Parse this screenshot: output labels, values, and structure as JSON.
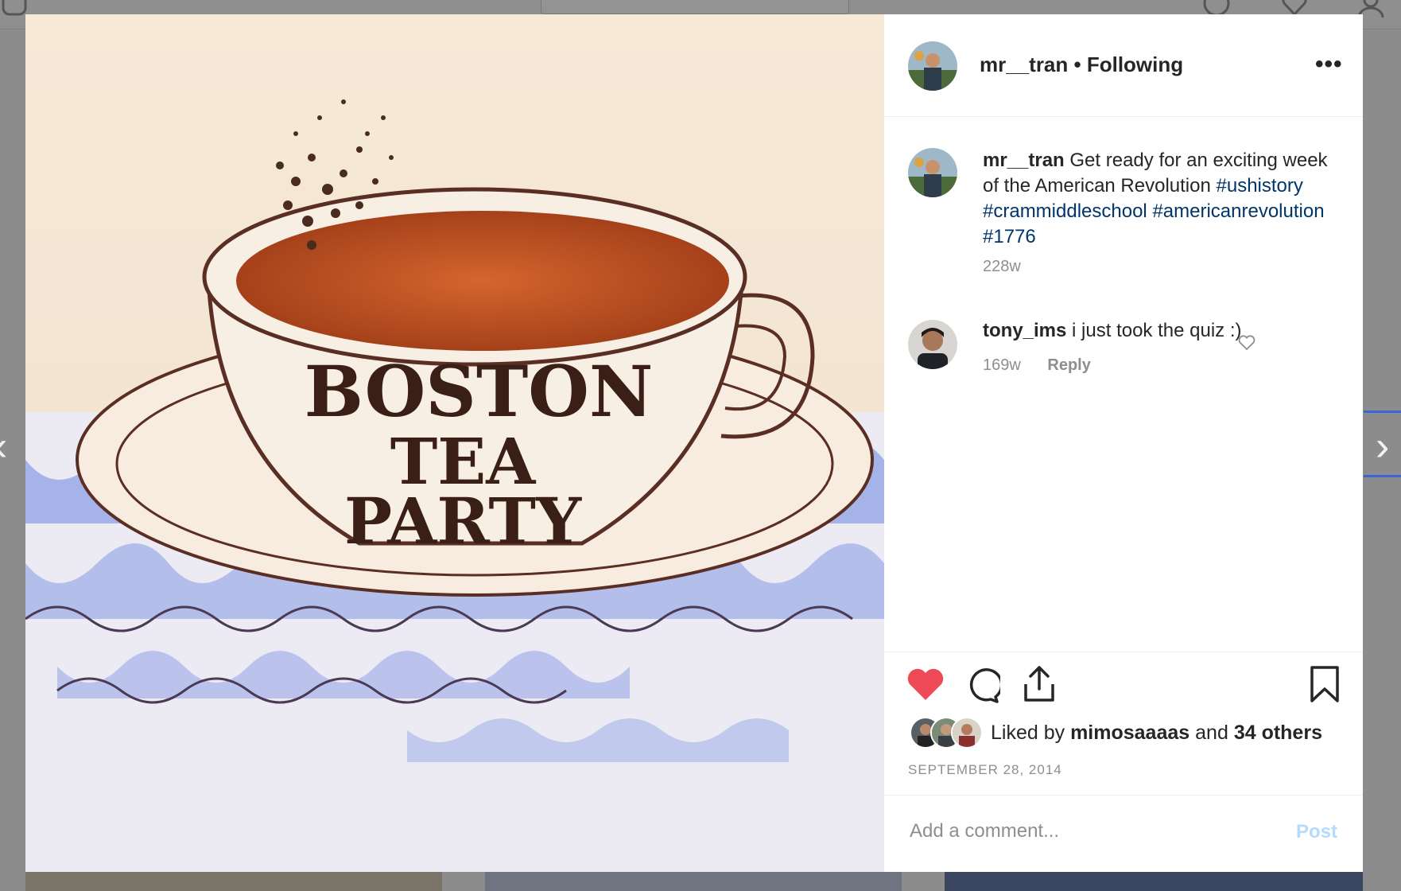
{
  "post": {
    "author": "mr__tran",
    "follow_status": "Following",
    "more_icon": "more-options-icon",
    "caption": {
      "username": "mr__tran",
      "text": "Get ready for an exciting week of the American Revolution",
      "hashtags": [
        "#ushistory",
        "#crammiddleschool",
        "#americanrevolution",
        "#1776"
      ],
      "age": "228w"
    },
    "image_text": [
      "BOSTON",
      "TEA",
      "PARTY"
    ],
    "comments": [
      {
        "username": "tony_ims",
        "text": "i just took the quiz :)",
        "age": "169w",
        "reply_label": "Reply"
      }
    ],
    "likes": {
      "prefix": "Liked by",
      "user": "mimosaaaas",
      "middle": "and",
      "others": "34 others"
    },
    "date": "SEPTEMBER 28, 2014",
    "add_comment": {
      "placeholder": "Add a comment...",
      "post_label": "Post"
    }
  },
  "colors": {
    "liked_heart": "#ed4956",
    "hashtag": "#003569",
    "post_disabled": "#b3dbff",
    "backdrop": "#8c8c8c"
  }
}
